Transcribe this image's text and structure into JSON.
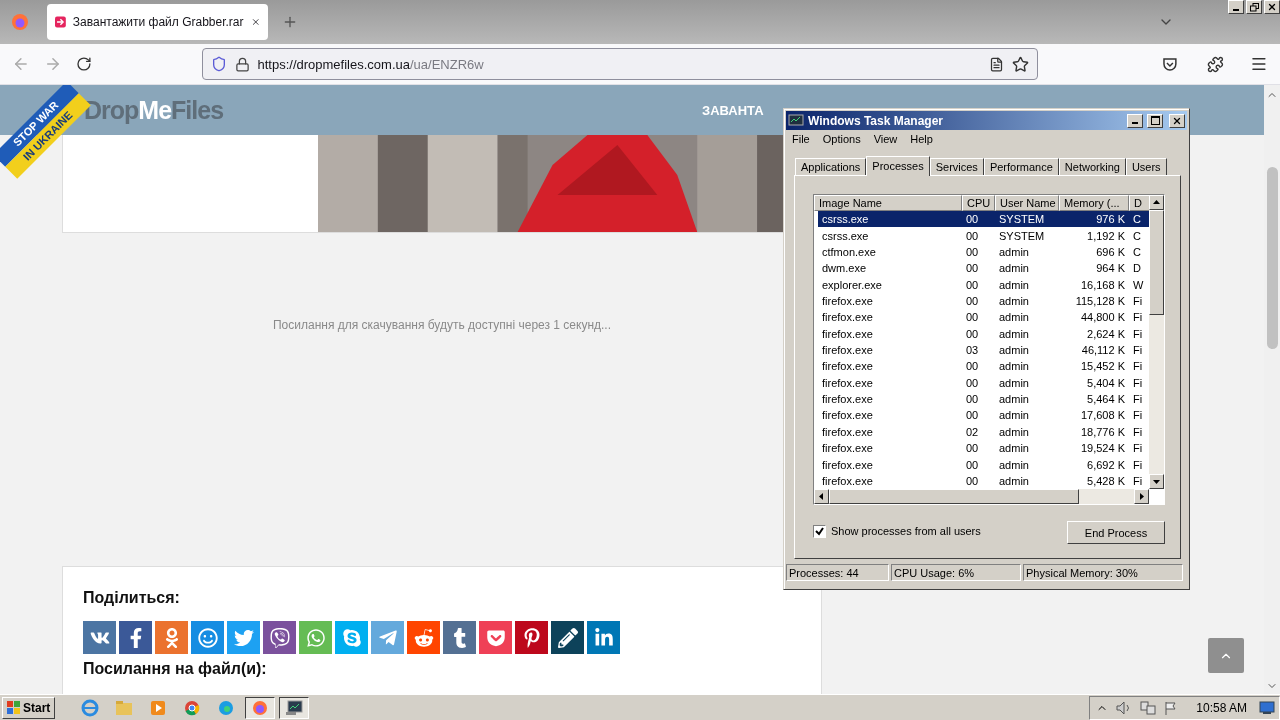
{
  "browser": {
    "tab_title": "Завантажити файл Grabber.rar",
    "url_host": "https://dropmefiles.com.ua",
    "url_path": "/ua/ENZR6w"
  },
  "site": {
    "logo": [
      {
        "text": "Drop",
        "kind": "dim"
      },
      {
        "text": "Me",
        "kind": "bright"
      },
      {
        "text": "Files",
        "kind": "dim"
      }
    ],
    "ribbon": [
      "STOP WAR",
      "IN UKRAINE"
    ],
    "nav": [
      "ЗАВАНТА"
    ],
    "notice": "Посилання для скачування будуть доступні через 1 секунд...",
    "share_heading": "Поділиться:",
    "share_buttons": [
      {
        "kind": "vk",
        "color": "#4c75a3"
      },
      {
        "kind": "facebook",
        "color": "#3b5998"
      },
      {
        "kind": "ok",
        "color": "#eb722e"
      },
      {
        "kind": "mail",
        "color": "#168de2"
      },
      {
        "kind": "twitter",
        "color": "#1da1f2"
      },
      {
        "kind": "viber",
        "color": "#7b519d"
      },
      {
        "kind": "whatsapp",
        "color": "#65bc54"
      },
      {
        "kind": "skype",
        "color": "#00aff0"
      },
      {
        "kind": "telegram",
        "color": "#64a9dc"
      },
      {
        "kind": "reddit",
        "color": "#ff4500"
      },
      {
        "kind": "tumblr",
        "color": "#547093"
      },
      {
        "kind": "pocket",
        "color": "#ef4056"
      },
      {
        "kind": "pinterest",
        "color": "#bd081c"
      },
      {
        "kind": "livejournal",
        "color": "#0d425a"
      },
      {
        "kind": "linkedin",
        "color": "#0077b5"
      }
    ],
    "links_heading": "Посилання на файл(и):"
  },
  "task_manager": {
    "title": "Windows Task Manager",
    "menu": [
      "File",
      "Options",
      "View",
      "Help"
    ],
    "tabs": [
      {
        "label": "Applications",
        "selected": false
      },
      {
        "label": "Processes",
        "selected": true
      },
      {
        "label": "Services",
        "selected": false
      },
      {
        "label": "Performance",
        "selected": false
      },
      {
        "label": "Networking",
        "selected": false
      },
      {
        "label": "Users",
        "selected": false
      }
    ],
    "columns": [
      "Image Name",
      "CPU",
      "User Name",
      "Memory (...",
      "D"
    ],
    "rows": [
      {
        "cells": [
          "csrss.exe",
          "00",
          "SYSTEM",
          "976 K",
          "C"
        ],
        "selected": true
      },
      {
        "cells": [
          "csrss.exe",
          "00",
          "SYSTEM",
          "1,192 K",
          "C"
        ],
        "selected": false
      },
      {
        "cells": [
          "ctfmon.exe",
          "00",
          "admin",
          "696 K",
          "C"
        ],
        "selected": false
      },
      {
        "cells": [
          "dwm.exe",
          "00",
          "admin",
          "964 K",
          "D"
        ],
        "selected": false
      },
      {
        "cells": [
          "explorer.exe",
          "00",
          "admin",
          "16,168 K",
          "W"
        ],
        "selected": false
      },
      {
        "cells": [
          "firefox.exe",
          "00",
          "admin",
          "115,128 K",
          "Fi"
        ],
        "selected": false
      },
      {
        "cells": [
          "firefox.exe",
          "00",
          "admin",
          "44,800 K",
          "Fi"
        ],
        "selected": false
      },
      {
        "cells": [
          "firefox.exe",
          "00",
          "admin",
          "2,624 K",
          "Fi"
        ],
        "selected": false
      },
      {
        "cells": [
          "firefox.exe",
          "03",
          "admin",
          "46,112 K",
          "Fi"
        ],
        "selected": false
      },
      {
        "cells": [
          "firefox.exe",
          "00",
          "admin",
          "15,452 K",
          "Fi"
        ],
        "selected": false
      },
      {
        "cells": [
          "firefox.exe",
          "00",
          "admin",
          "5,404 K",
          "Fi"
        ],
        "selected": false
      },
      {
        "cells": [
          "firefox.exe",
          "00",
          "admin",
          "5,464 K",
          "Fi"
        ],
        "selected": false
      },
      {
        "cells": [
          "firefox.exe",
          "00",
          "admin",
          "17,608 K",
          "Fi"
        ],
        "selected": false
      },
      {
        "cells": [
          "firefox.exe",
          "02",
          "admin",
          "18,776 K",
          "Fi"
        ],
        "selected": false
      },
      {
        "cells": [
          "firefox.exe",
          "00",
          "admin",
          "19,524 K",
          "Fi"
        ],
        "selected": false
      },
      {
        "cells": [
          "firefox.exe",
          "00",
          "admin",
          "6,692 K",
          "Fi"
        ],
        "selected": false
      },
      {
        "cells": [
          "firefox.exe",
          "00",
          "admin",
          "5,428 K",
          "Fi"
        ],
        "selected": false
      }
    ],
    "show_all_users": {
      "label": "Show processes from all users",
      "checked": true
    },
    "end_button": "End Process",
    "status": [
      "Processes: 44",
      "CPU Usage: 6%",
      "Physical Memory: 30%"
    ]
  },
  "taskbar": {
    "start": "Start",
    "clock": "10:58 AM"
  }
}
